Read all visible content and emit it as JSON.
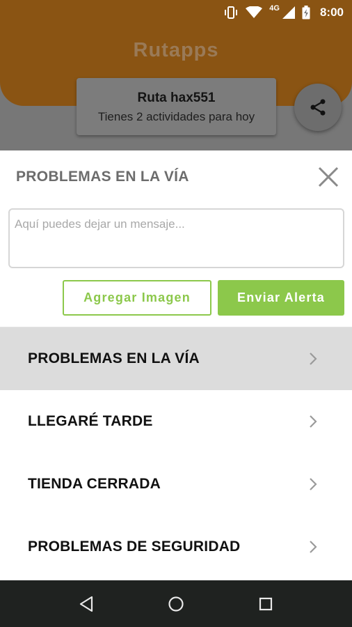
{
  "status_bar": {
    "time": "8:00",
    "network": "4G",
    "icons": [
      "vibrate-icon",
      "wifi-icon",
      "signal-icon",
      "battery-icon"
    ]
  },
  "app": {
    "logo": "Rutapps"
  },
  "route_card": {
    "title": "Ruta hax551",
    "subtitle": "Tienes 2 actividades para hoy"
  },
  "share_button": {
    "icon": "share-icon"
  },
  "sheet": {
    "title": "PROBLEMAS EN LA VÍA",
    "close_icon": "close-icon",
    "message": {
      "value": "",
      "placeholder": "Aquí puedes dejar un mensaje..."
    },
    "add_image_label": "Agregar Imagen",
    "send_alert_label": "Enviar Alerta"
  },
  "issues": [
    {
      "label": "PROBLEMAS EN LA VÍA",
      "selected": true
    },
    {
      "label": "LLEGARÉ TARDE",
      "selected": false
    },
    {
      "label": "TIENDA CERRADA",
      "selected": false
    },
    {
      "label": "PROBLEMAS DE SEGURIDAD",
      "selected": false
    }
  ],
  "colors": {
    "accent_green": "#8cc84b",
    "header_brown": "#8a5413",
    "selected_row": "#dcdcdc",
    "nav_bar": "#1f2220"
  },
  "nav_bar": {
    "icons": [
      "back-icon",
      "home-icon",
      "recents-icon"
    ]
  }
}
